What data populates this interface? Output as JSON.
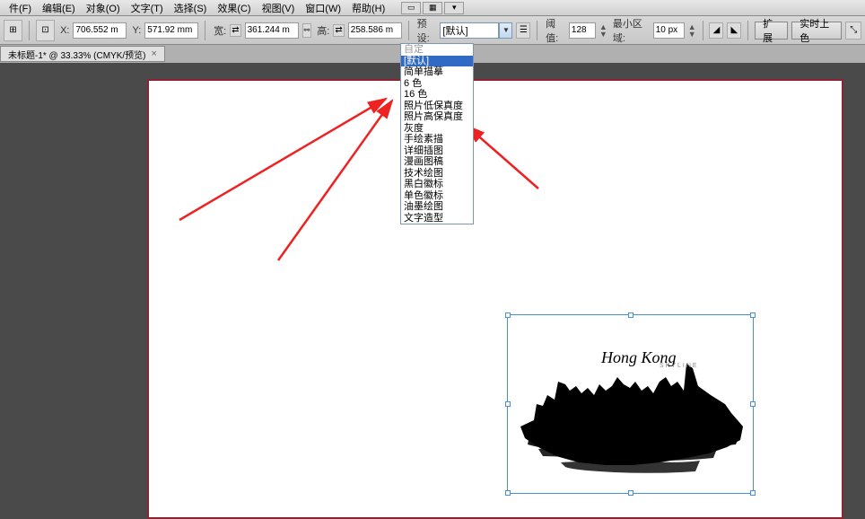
{
  "menu": {
    "items": [
      "件(F)",
      "编辑(E)",
      "对象(O)",
      "文字(T)",
      "选择(S)",
      "效果(C)",
      "视图(V)",
      "窗口(W)",
      "帮助(H)"
    ]
  },
  "toolbar": {
    "x_label": "X:",
    "x_value": "706.552 m",
    "y_label": "Y:",
    "y_value": "571.92 mm",
    "w_label": "宽:",
    "w_value": "361.244 m",
    "h_label": "高:",
    "h_value": "258.586 m",
    "preset_label": "预设:",
    "preset_value": "[默认]",
    "threshold_label": "阈值:",
    "threshold_value": "128",
    "minarea_label": "最小区域:",
    "minarea_value": "10 px",
    "expand_btn": "扩展",
    "realtime_btn": "实时上色"
  },
  "tab": {
    "title": "未标题-1* @ 33.33% (CMYK/预览)",
    "close": "×"
  },
  "dropdown": {
    "items": [
      {
        "label": "自定",
        "state": "disabled"
      },
      {
        "label": "[默认]",
        "state": "selected"
      },
      {
        "label": "简单描摹",
        "state": ""
      },
      {
        "label": "6 色",
        "state": ""
      },
      {
        "label": "16 色",
        "state": ""
      },
      {
        "label": "照片低保真度",
        "state": ""
      },
      {
        "label": "照片高保真度",
        "state": ""
      },
      {
        "label": "灰度",
        "state": ""
      },
      {
        "label": "手绘素描",
        "state": ""
      },
      {
        "label": "详细插图",
        "state": ""
      },
      {
        "label": "漫画图稿",
        "state": ""
      },
      {
        "label": "技术绘图",
        "state": ""
      },
      {
        "label": "黑白徽标",
        "state": ""
      },
      {
        "label": "单色徽标",
        "state": ""
      },
      {
        "label": "油墨绘图",
        "state": ""
      },
      {
        "label": "文字造型",
        "state": ""
      }
    ]
  },
  "image": {
    "title": "Hong Kong",
    "subtitle": "SKYLINE"
  }
}
